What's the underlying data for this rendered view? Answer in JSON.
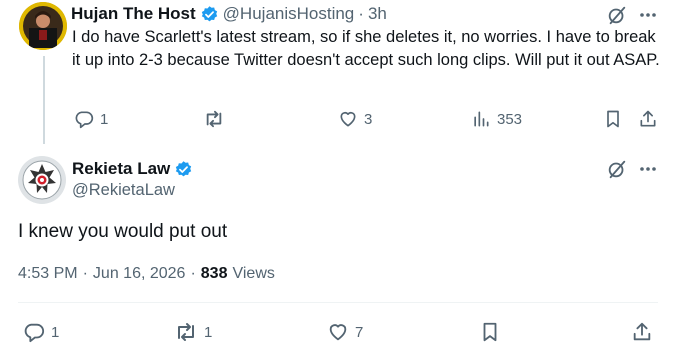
{
  "reply_tweet": {
    "display_name": "Hujan The Host",
    "handle": "@HujanisHosting",
    "separator": "·",
    "time": "3h",
    "text": "I do have Scarlett's latest stream, so if she deletes it, no worries. I have to break it up into 2-3 because Twitter doesn't accept such long clips. Will put it out ASAP.",
    "actions": {
      "replies": "1",
      "reposts": "",
      "likes": "3",
      "views": "353"
    }
  },
  "main_tweet": {
    "display_name": "Rekieta Law",
    "handle": "@RekietaLaw",
    "text": "I knew you would put out",
    "time": "4:53 PM",
    "date_separator": "·",
    "date": "Jun 16, 2026",
    "views_separator": "·",
    "views_count": "838",
    "views_label": "Views",
    "actions": {
      "replies": "1",
      "reposts": "1",
      "likes": "7"
    }
  },
  "colors": {
    "verified": "#1d9bf0",
    "text": "#0f1419",
    "muted": "#536471",
    "divider": "#eff3f4"
  }
}
